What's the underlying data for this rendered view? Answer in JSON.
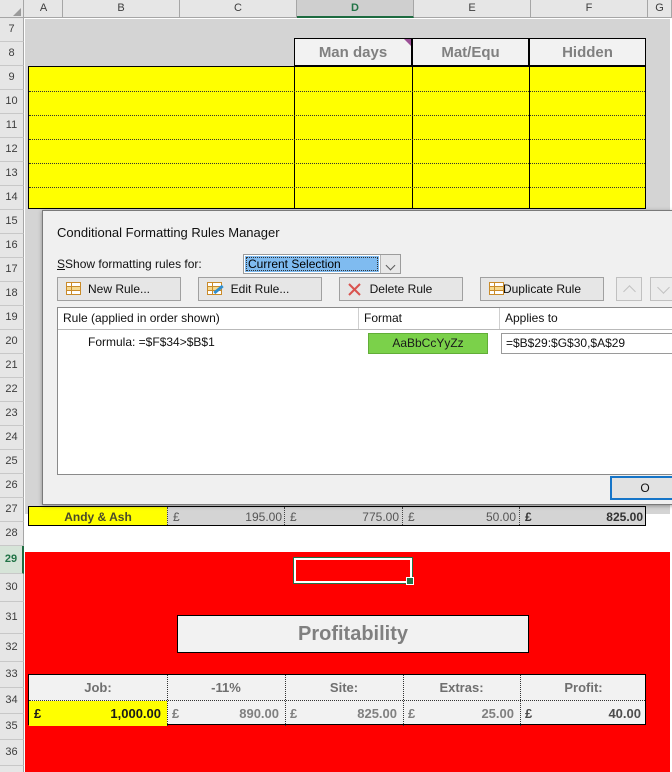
{
  "grid": {
    "columns": [
      "A",
      "B",
      "C",
      "D",
      "E",
      "F",
      "G"
    ],
    "selected_column": "D",
    "rows": [
      "7",
      "8",
      "9",
      "10",
      "11",
      "12",
      "13",
      "14",
      "15",
      "16",
      "17",
      "18",
      "19",
      "20",
      "21",
      "22",
      "23",
      "24",
      "25",
      "26",
      "27",
      "28",
      "29",
      "30",
      "31",
      "32",
      "33",
      "34",
      "35",
      "36"
    ],
    "selected_row": "29",
    "headers_row8": [
      "Man days",
      "Mat/Equ",
      "Hidden"
    ],
    "comment_indicator_on": "Man days"
  },
  "hidden_row": {
    "name": "Andy & Ash",
    "cells": [
      {
        "currency": "£",
        "amount": "195.00"
      },
      {
        "currency": "£",
        "amount": "775.00"
      },
      {
        "currency": "£",
        "amount": "50.00"
      },
      {
        "currency": "£",
        "amount": "825.00"
      }
    ]
  },
  "banner": {
    "title": "Profitability"
  },
  "profit_table": {
    "headers": [
      "Job:",
      "-11%",
      "Site:",
      "Extras:",
      "Profit:"
    ],
    "values": [
      {
        "currency": "£",
        "amount": "1,000.00",
        "highlight": true
      },
      {
        "currency": "£",
        "amount": "890.00",
        "highlight": false
      },
      {
        "currency": "£",
        "amount": "825.00",
        "highlight": false
      },
      {
        "currency": "£",
        "amount": "25.00",
        "highlight": false
      },
      {
        "currency": "£",
        "amount": "40.00",
        "highlight": false
      }
    ]
  },
  "dialog": {
    "title": "Conditional Formatting Rules Manager",
    "show_rules_label": "Show formatting rules for:",
    "show_rules_value": "Current Selection",
    "buttons": {
      "new_rule": "New Rule...",
      "edit_rule": "Edit Rule...",
      "delete_rule": "Delete Rule",
      "duplicate_rule": "Duplicate Rule",
      "ok": "O"
    },
    "list_headers": {
      "rule": "Rule (applied in order shown)",
      "format": "Format",
      "applies_to": "Applies to"
    },
    "rules": [
      {
        "rule": "Formula:  =$F$34>$B$1",
        "format_preview": "AaBbCcYyZz",
        "format_color": "#7bd14a",
        "applies_to": "=$B$29:$G$30,$A$29"
      }
    ]
  },
  "colors": {
    "highlight_yellow": "#ffff00",
    "alert_red": "#ff0000",
    "excel_green": "#217346",
    "format_green": "#7bd14a",
    "focus_blue": "#1675c8"
  }
}
